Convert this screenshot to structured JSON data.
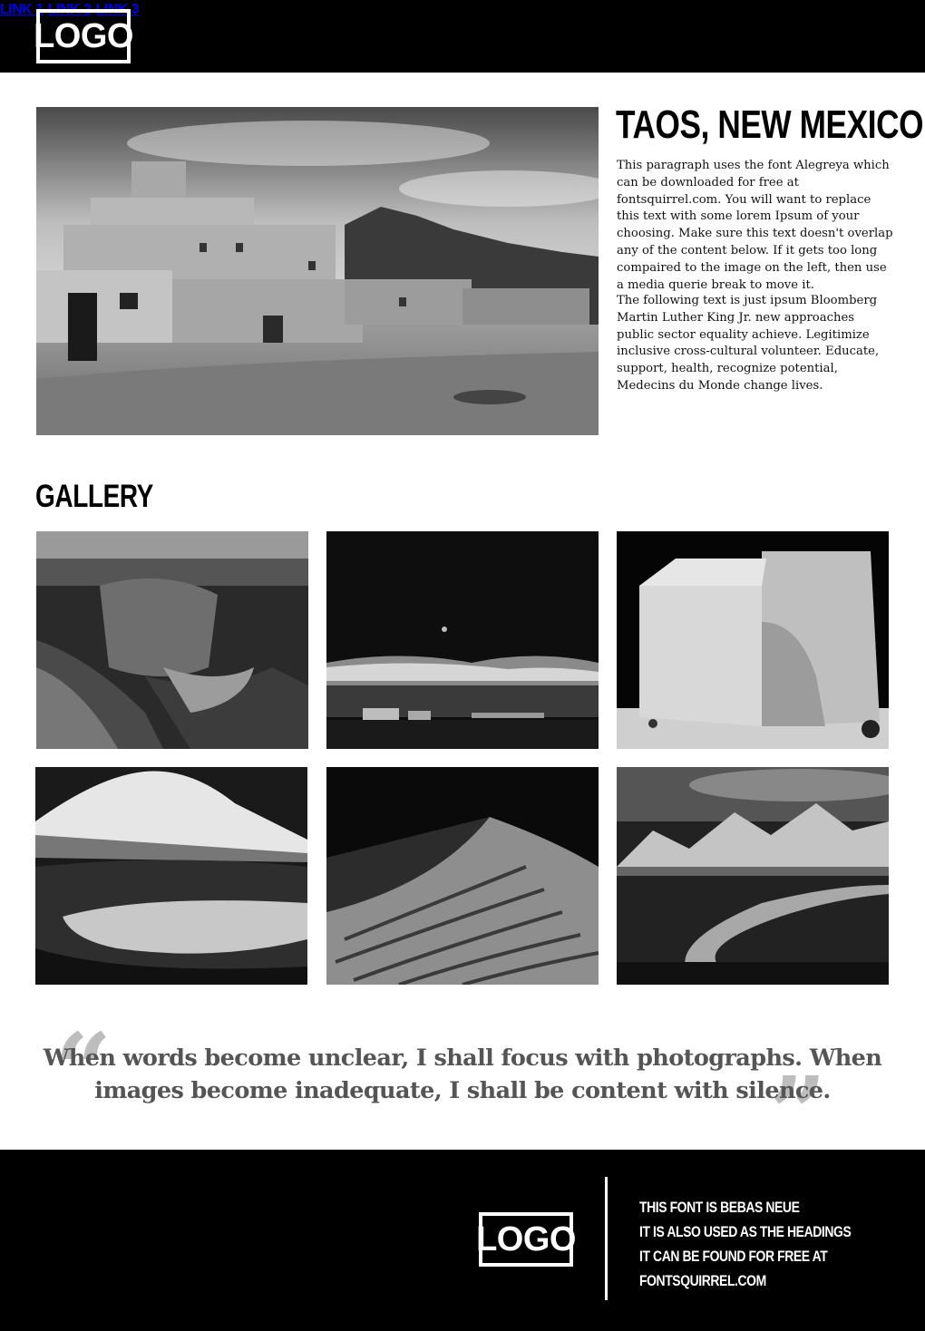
{
  "header": {
    "logo": "LOGO",
    "nav": [
      "LINK 1",
      "LINK 2",
      "LINK 3"
    ]
  },
  "hero": {
    "image_alt": "Taos Pueblo adobe buildings",
    "title": "TAOS, NEW MEXICO",
    "paragraph1": "This paragraph uses the font Alegreya which can be downloaded for free at fontsquirrel.com. You will want to replace this text with some lorem Ipsum of your choosing. Make sure this text doesn't overlap any of the content below. If it gets too long compaired to the image on the left, then use a media querie break to move it.",
    "paragraph2": "The following text is just ipsum Bloomberg Martin Luther King Jr. new approaches public sector equality achieve. Legitimize inclusive cross-cultural volunteer. Educate, support, health, recognize potential, Medecins du Monde change lives."
  },
  "gallery": {
    "title": "GALLERY"
  },
  "quote": {
    "text": "When words become unclear, I shall focus with photographs. When images become inadequate, I shall be content with silence."
  },
  "footer": {
    "logo": "LOGO",
    "lines": [
      "THIS FONT IS BEBAS NEUE",
      "IT IS ALSO USED AS THE HEADINGS",
      "IT CAN BE FOUND FOR FREE AT",
      "FONTSQUIRREL.COM"
    ]
  },
  "colors": {
    "header_bg": "#000000",
    "footer_bg": "#000000",
    "quote_text": "#555555",
    "quote_marks": "#bdbdbd"
  }
}
